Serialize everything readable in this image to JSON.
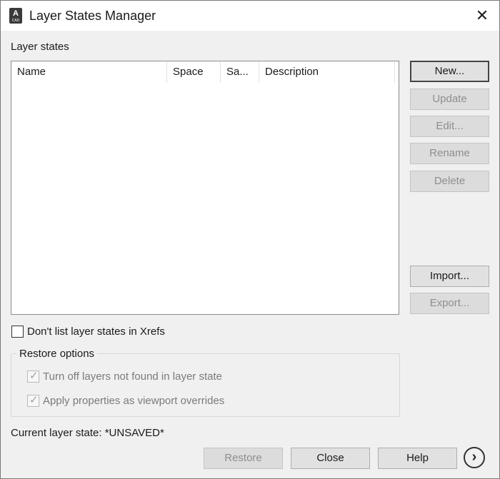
{
  "window": {
    "title": "Layer States Manager",
    "app_icon_letter": "A",
    "app_icon_sub": "CAD",
    "close_glyph": "✕",
    "close_icon": "close-icon"
  },
  "layer_states": {
    "label": "Layer states",
    "columns": [
      "Name",
      "Space",
      "Sa...",
      "Description"
    ],
    "rows": []
  },
  "side_buttons": {
    "new": "New...",
    "update": "Update",
    "edit": "Edit...",
    "rename": "Rename",
    "delete": "Delete",
    "import": "Import...",
    "export": "Export..."
  },
  "xref_option": {
    "label": "Don't list layer states in Xrefs",
    "checked": false
  },
  "restore_options": {
    "legend": "Restore options",
    "turn_off_layers": "Turn off layers not found in layer state",
    "apply_properties": "Apply properties as viewport overrides",
    "turn_off_checked": true,
    "apply_checked": true,
    "check_glyph": "✓"
  },
  "status": {
    "current_layer_state": "Current layer state: *UNSAVED*"
  },
  "bottom_buttons": {
    "restore": "Restore",
    "close": "Close",
    "help": "Help",
    "more_glyph": "›"
  },
  "colors": {
    "dialog_bg": "#f0f0f0",
    "titlebar_bg": "#ffffff",
    "disabled_text": "#8e8e8e"
  }
}
